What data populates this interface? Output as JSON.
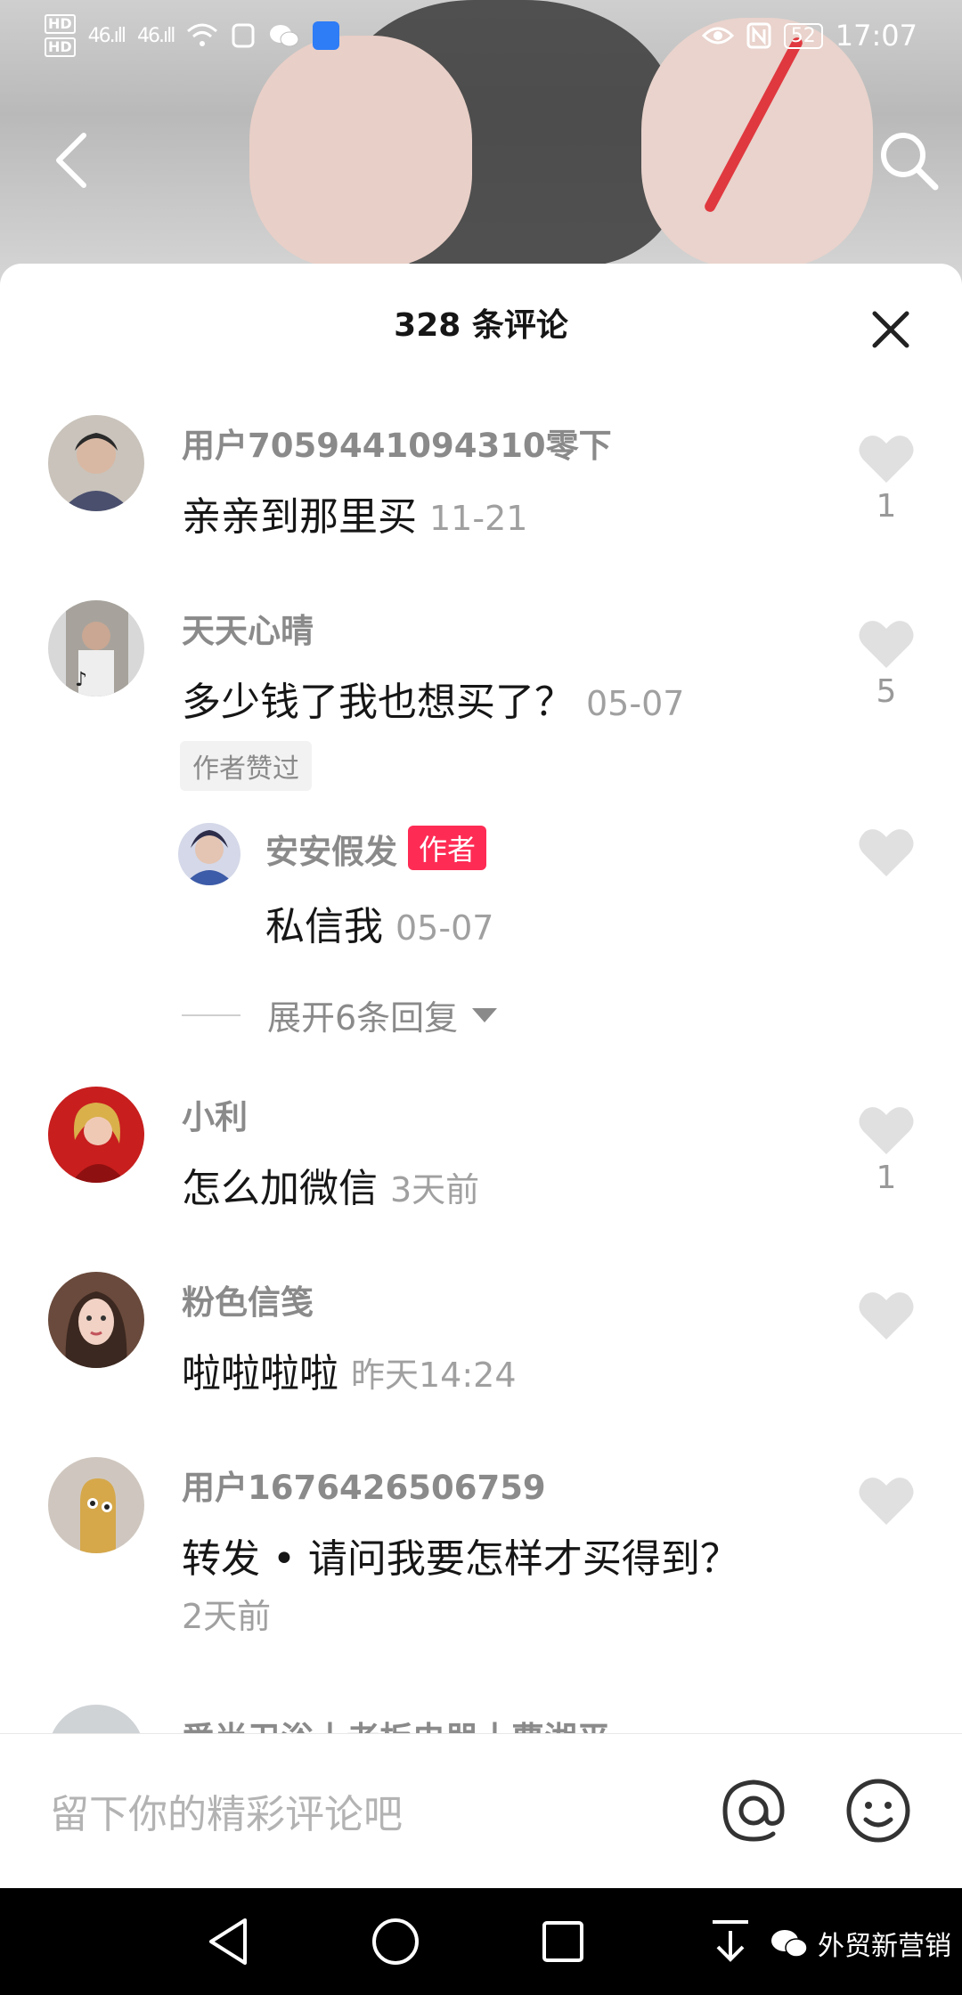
{
  "status_bar": {
    "hd1": "HD",
    "hd2": "HD",
    "signal1": "46.ıll",
    "signal2": "46.ıll",
    "battery": "52",
    "time": "17:07"
  },
  "sheet": {
    "title": "328 条评论"
  },
  "comments": [
    {
      "name": "用户7059441094310零下",
      "text": "亲亲到那里买",
      "time": "11-21",
      "likes": "1"
    },
    {
      "name": "天天心晴",
      "text": "多少钱了我也想买了？",
      "time": "05-07",
      "likes": "5",
      "badge": "作者赞过"
    },
    {
      "name": "小利",
      "text": "怎么加微信",
      "time": "3天前",
      "likes": "1"
    },
    {
      "name": "粉色信笺",
      "text": "啦啦啦啦",
      "time": "昨天14:24",
      "likes": ""
    },
    {
      "name": "用户1676426506759",
      "text": "转发 • 请问我要怎样才买得到？",
      "time": "2天前",
      "likes": ""
    }
  ],
  "reply": {
    "name": "安安假发",
    "author_tag": "作者",
    "text": "私信我",
    "time": "05-07",
    "expand_label": "展开6条回复"
  },
  "next_comment_name": "爱尚卫浴丨老板电器丨曹湘平",
  "input_bar": {
    "placeholder": "留下你的精彩评论吧"
  },
  "watermark": {
    "text": "外贸新营销"
  },
  "colors": {
    "accent": "#fe2c55",
    "muted_text": "#8a8a8a",
    "heart": "#e0e0e0"
  }
}
